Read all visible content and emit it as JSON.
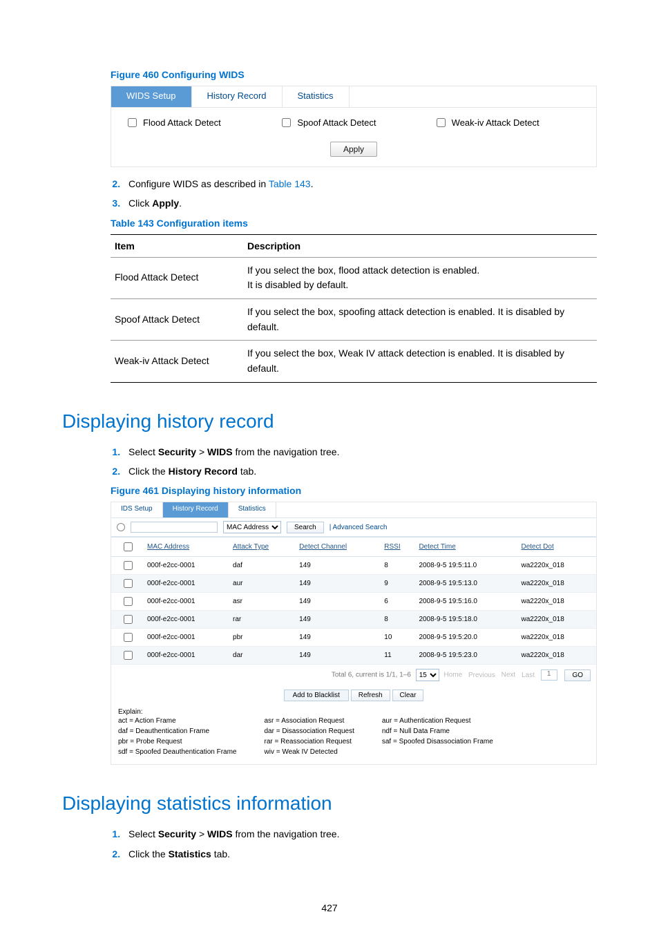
{
  "figure460": {
    "caption": "Figure 460 Configuring WIDS",
    "tabs": {
      "setup": "WIDS Setup",
      "history": "History Record",
      "stats": "Statistics"
    },
    "checks": {
      "flood": "Flood Attack Detect",
      "spoof": "Spoof Attack Detect",
      "weak": "Weak-iv Attack Detect"
    },
    "apply": "Apply"
  },
  "step2": {
    "pre": "Configure WIDS as described in ",
    "link": "Table 143",
    "post": "."
  },
  "step3": {
    "pre": "Click ",
    "b": "Apply",
    "post": "."
  },
  "table143": {
    "caption": "Table 143 Configuration items",
    "head": {
      "item": "Item",
      "desc": "Description"
    },
    "rows": [
      {
        "item": "Flood Attack Detect",
        "desc": "If you select the box, flood attack detection is enabled.\nIt is disabled by default."
      },
      {
        "item": "Spoof Attack Detect",
        "desc": "If you select the box, spoofing attack detection is enabled. It is disabled by default."
      },
      {
        "item": "Weak-iv Attack Detect",
        "desc": "If you select the box, Weak IV attack detection is enabled. It is disabled by default."
      }
    ]
  },
  "sectionHistory": {
    "title": "Displaying history record",
    "s1": {
      "pre": "Select ",
      "b1": "Security",
      "mid": " > ",
      "b2": "WIDS",
      "post": " from the navigation tree."
    },
    "s2": {
      "pre": "Click the ",
      "b": "History Record",
      "post": " tab."
    }
  },
  "figure461": {
    "caption": "Figure 461 Displaying history information",
    "tabs": {
      "setup": "IDS Setup",
      "history": "History Record",
      "stats": "Statistics"
    },
    "searchLabel": "MAC Address",
    "search": "Search",
    "advanced": "| Advanced Search",
    "head": [
      "MAC Address",
      "Attack Type",
      "Detect Channel",
      "RSSI",
      "Detect Time",
      "Detect Dot"
    ],
    "rows": [
      {
        "mac": "000f-e2cc-0001",
        "atk": "daf",
        "ch": "149",
        "rssi": "8",
        "time": "2008-9-5 19:5:11.0",
        "dot": "wa2220x_018"
      },
      {
        "mac": "000f-e2cc-0001",
        "atk": "aur",
        "ch": "149",
        "rssi": "9",
        "time": "2008-9-5 19:5:13.0",
        "dot": "wa2220x_018"
      },
      {
        "mac": "000f-e2cc-0001",
        "atk": "asr",
        "ch": "149",
        "rssi": "6",
        "time": "2008-9-5 19:5:16.0",
        "dot": "wa2220x_018"
      },
      {
        "mac": "000f-e2cc-0001",
        "atk": "rar",
        "ch": "149",
        "rssi": "8",
        "time": "2008-9-5 19:5:18.0",
        "dot": "wa2220x_018"
      },
      {
        "mac": "000f-e2cc-0001",
        "atk": "pbr",
        "ch": "149",
        "rssi": "10",
        "time": "2008-9-5 19:5:20.0",
        "dot": "wa2220x_018"
      },
      {
        "mac": "000f-e2cc-0001",
        "atk": "dar",
        "ch": "149",
        "rssi": "11",
        "time": "2008-9-5 19:5:23.0",
        "dot": "wa2220x_018"
      }
    ],
    "pager": {
      "total": "Total 6, current is 1/1, 1–6",
      "perpage": "15",
      "home": "Home",
      "prev": "Previous",
      "next": "Next",
      "last": "Last",
      "pg": "1",
      "go": "GO"
    },
    "buttons": {
      "black": "Add to Blacklist",
      "refresh": "Refresh",
      "clear": "Clear"
    },
    "explainTitle": "Explain:",
    "explain": {
      "c1": [
        "act = Action Frame",
        "daf = Deauthentication Frame",
        "pbr = Probe Request",
        "sdf = Spoofed Deauthentication Frame"
      ],
      "c2": [
        "asr = Association Request",
        "dar = Disassociation Request",
        "rar = Reassociation Request",
        "wiv = Weak IV Detected"
      ],
      "c3": [
        "aur = Authentication Request",
        "ndf = Null Data Frame",
        "saf = Spoofed Disassociation Frame"
      ]
    }
  },
  "sectionStats": {
    "title": "Displaying statistics information",
    "s1": {
      "pre": "Select ",
      "b1": "Security",
      "mid": " > ",
      "b2": "WIDS",
      "post": " from the navigation tree."
    },
    "s2": {
      "pre": "Click the ",
      "b": "Statistics",
      "post": " tab."
    }
  },
  "pageNumber": "427"
}
